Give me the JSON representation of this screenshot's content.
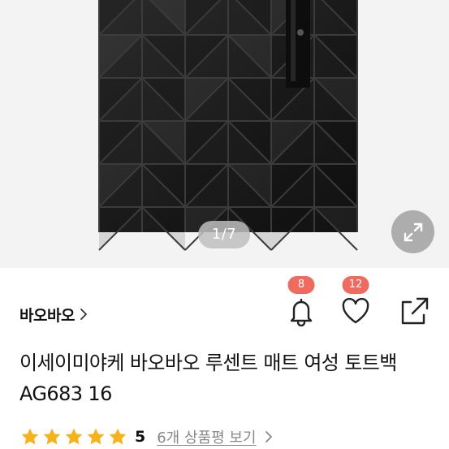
{
  "gallery": {
    "indicator": "1/7",
    "expand_icon": "expand-arrows-icon"
  },
  "product": {
    "brand": "바오바오",
    "title": "이세이미야케 바오바오 루센트 매트 여성 토트백 AG683 16",
    "rating": "5",
    "review_link": "6개 상품평 보기",
    "stars": 5
  },
  "actions": {
    "alerts_count": "8",
    "likes_count": "12"
  },
  "colors": {
    "badge": "#ef6b5d",
    "star": "#f5b21a",
    "bag": "#1c1c1c"
  }
}
